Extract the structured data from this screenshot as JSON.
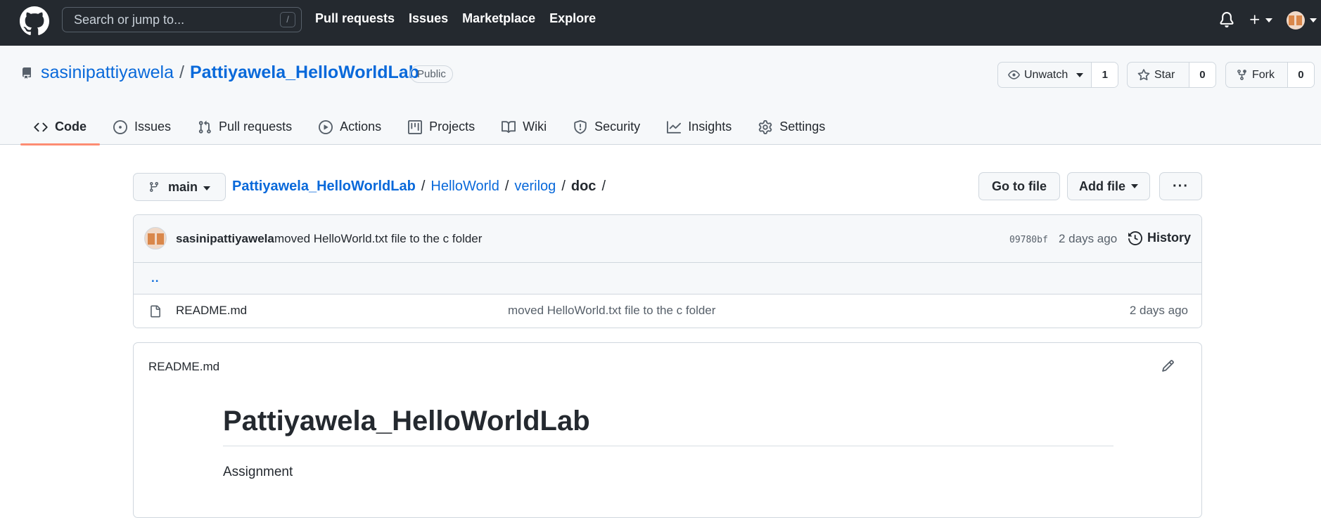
{
  "header": {
    "search_placeholder": "Search or jump to...",
    "search_shortcut": "/",
    "nav": [
      "Pull requests",
      "Issues",
      "Marketplace",
      "Explore"
    ],
    "icons": [
      "github-logo",
      "bell-icon",
      "plus-icon",
      "avatar"
    ]
  },
  "repo": {
    "owner": "sasinipattiyawela",
    "name": "Pattiyawela_HelloWorldLab",
    "visibility": "Public",
    "watch_label": "Unwatch",
    "watch_count": "1",
    "star_label": "Star",
    "star_count": "0",
    "fork_label": "Fork",
    "fork_count": "0"
  },
  "tabs": [
    {
      "label": "Code",
      "icon": "code-icon",
      "active": true
    },
    {
      "label": "Issues",
      "icon": "issue-icon"
    },
    {
      "label": "Pull requests",
      "icon": "pull-request-icon"
    },
    {
      "label": "Actions",
      "icon": "play-icon"
    },
    {
      "label": "Projects",
      "icon": "table-icon"
    },
    {
      "label": "Wiki",
      "icon": "book-icon"
    },
    {
      "label": "Security",
      "icon": "shield-icon"
    },
    {
      "label": "Insights",
      "icon": "graph-icon"
    },
    {
      "label": "Settings",
      "icon": "gear-icon"
    }
  ],
  "browser": {
    "branch": "main",
    "breadcrumb": [
      "Pattiyawela_HelloWorldLab",
      "HelloWorld",
      "verilog",
      "doc"
    ],
    "sep": "/",
    "go_to_file": "Go to file",
    "add_file": "Add file",
    "more": "···"
  },
  "commit": {
    "author": "sasinipattiyawela",
    "message": "moved HelloWorld.txt file to the c folder",
    "sha": "09780bf",
    "time": "2 days ago",
    "history": "History"
  },
  "files": {
    "parent": "..",
    "rows": [
      {
        "name": "README.md",
        "message": "moved HelloWorld.txt file to the c folder",
        "time": "2 days ago"
      }
    ]
  },
  "readme": {
    "filename": "README.md",
    "heading": "Pattiyawela_HelloWorldLab",
    "body": "Assignment"
  },
  "colors": {
    "header_bg": "#24292f",
    "link": "#0969da",
    "active_tab_underline": "#fd8c73",
    "subtle_bg": "#f6f8fa",
    "border": "#d0d7de"
  }
}
